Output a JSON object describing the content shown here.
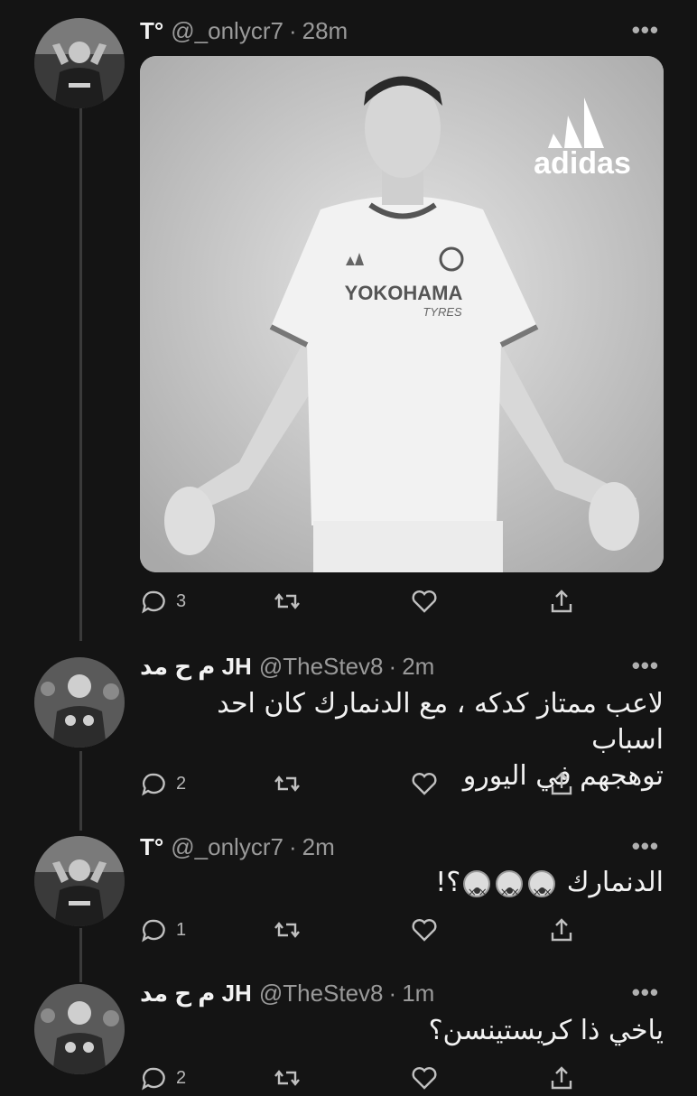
{
  "tweets": [
    {
      "name": "T°",
      "handle": "@_onlycr7",
      "separator": "·",
      "time": "28m",
      "more": "•••",
      "text": "",
      "media": {
        "brand_logo_text": "adidas",
        "shirt_sponsor": "YOKOHAMA",
        "shirt_sponsor_sub": "TYRES"
      },
      "replies": "3",
      "icons": [
        "reply-icon",
        "retweet-icon",
        "like-icon",
        "share-icon"
      ]
    },
    {
      "name": "م ح مد JH",
      "handle": "@TheStev8",
      "separator": "·",
      "time": "2m",
      "more": "•••",
      "text_line1": "لاعب ممتاز كدكه ، مع الدنمارك كان احد اسباب",
      "text_line2": "توهجهم في اليورو",
      "replies": "2"
    },
    {
      "name": "T°",
      "handle": "@_onlycr7",
      "separator": "·",
      "time": "2m",
      "more": "•••",
      "text": "الدنمارك",
      "text_suffix": "؟!",
      "emoji": "dizzy-face-icon",
      "replies": "1"
    },
    {
      "name": "م ح مد JH",
      "handle": "@TheStev8",
      "separator": "·",
      "time": "1m",
      "more": "•••",
      "text": "ياخي ذا كريستينسن؟",
      "replies": "2"
    }
  ],
  "colors": {
    "background": "#141414",
    "text": "#f2f2f2",
    "muted": "#9a9a9a",
    "thread_line": "#3a3a3a"
  }
}
